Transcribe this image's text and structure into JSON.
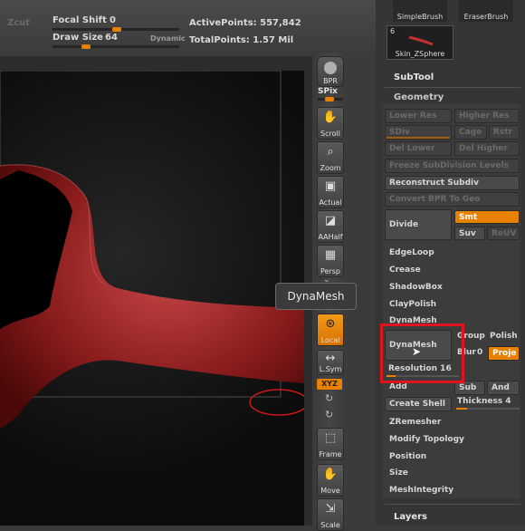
{
  "topbar": {
    "zcut": "Zcut",
    "focal_shift_label": "Focal Shift",
    "focal_shift_value": "0",
    "draw_size_label": "Draw Size",
    "draw_size_value": "64",
    "dynamic_label": "Dynamic",
    "active_points": "ActivePoints: 557,842",
    "total_points": "TotalPoints: 1.57 Mil"
  },
  "brushes": {
    "simple_brush": "SimpleBrush",
    "eraser_brush": "EraserBrush",
    "tool_count": "6",
    "tool_name": "Skin_ZSphere"
  },
  "shelf": {
    "bpr": "BPR",
    "spix": "SPix",
    "scroll": "Scroll",
    "zoom": "Zoom",
    "actual": "Actual",
    "aahalf": "AAHalf",
    "persp": "Persp",
    "local": "Local",
    "lsym": "L.Sym",
    "xyz": "XYZ",
    "frame": "Frame",
    "move": "Move",
    "scale": "Scale"
  },
  "tooltip": "DynaMesh",
  "panel": {
    "subtool": "SubTool",
    "geometry": "Geometry",
    "lower_res": "Lower Res",
    "higher_res": "Higher Res",
    "sdiv": "SDiv",
    "cage": "Cage",
    "rstr": "Rstr",
    "del_lower": "Del Lower",
    "del_higher": "Del Higher",
    "freeze_subdiv": "Freeze SubDivision Levels",
    "reconstruct_subdiv": "Reconstruct Subdiv",
    "convert_bpr": "Convert BPR To Geo",
    "divide": "Divide",
    "smt": "Smt",
    "suv": "Suv",
    "reuv": "ReUV",
    "edgeloop": "EdgeLoop",
    "crease": "Crease",
    "shadowbox": "ShadowBox",
    "claypolish": "ClayPolish",
    "dynamesh_head": "DynaMesh",
    "dynamesh_btn": "DynaMesh",
    "group": "Group",
    "polish": "Polish",
    "blur": "Blur",
    "blur_val": "0",
    "project": "Proje",
    "resolution": "Resolution 16",
    "add": "Add",
    "sub": "Sub",
    "and": "And",
    "create_shell": "Create Shell",
    "thickness": "Thickness 4",
    "zremesher": "ZRemesher",
    "modify_topology": "Modify Topology",
    "position": "Position",
    "size": "Size",
    "meshintegrity": "MeshIntegrity",
    "layers": "Layers"
  }
}
